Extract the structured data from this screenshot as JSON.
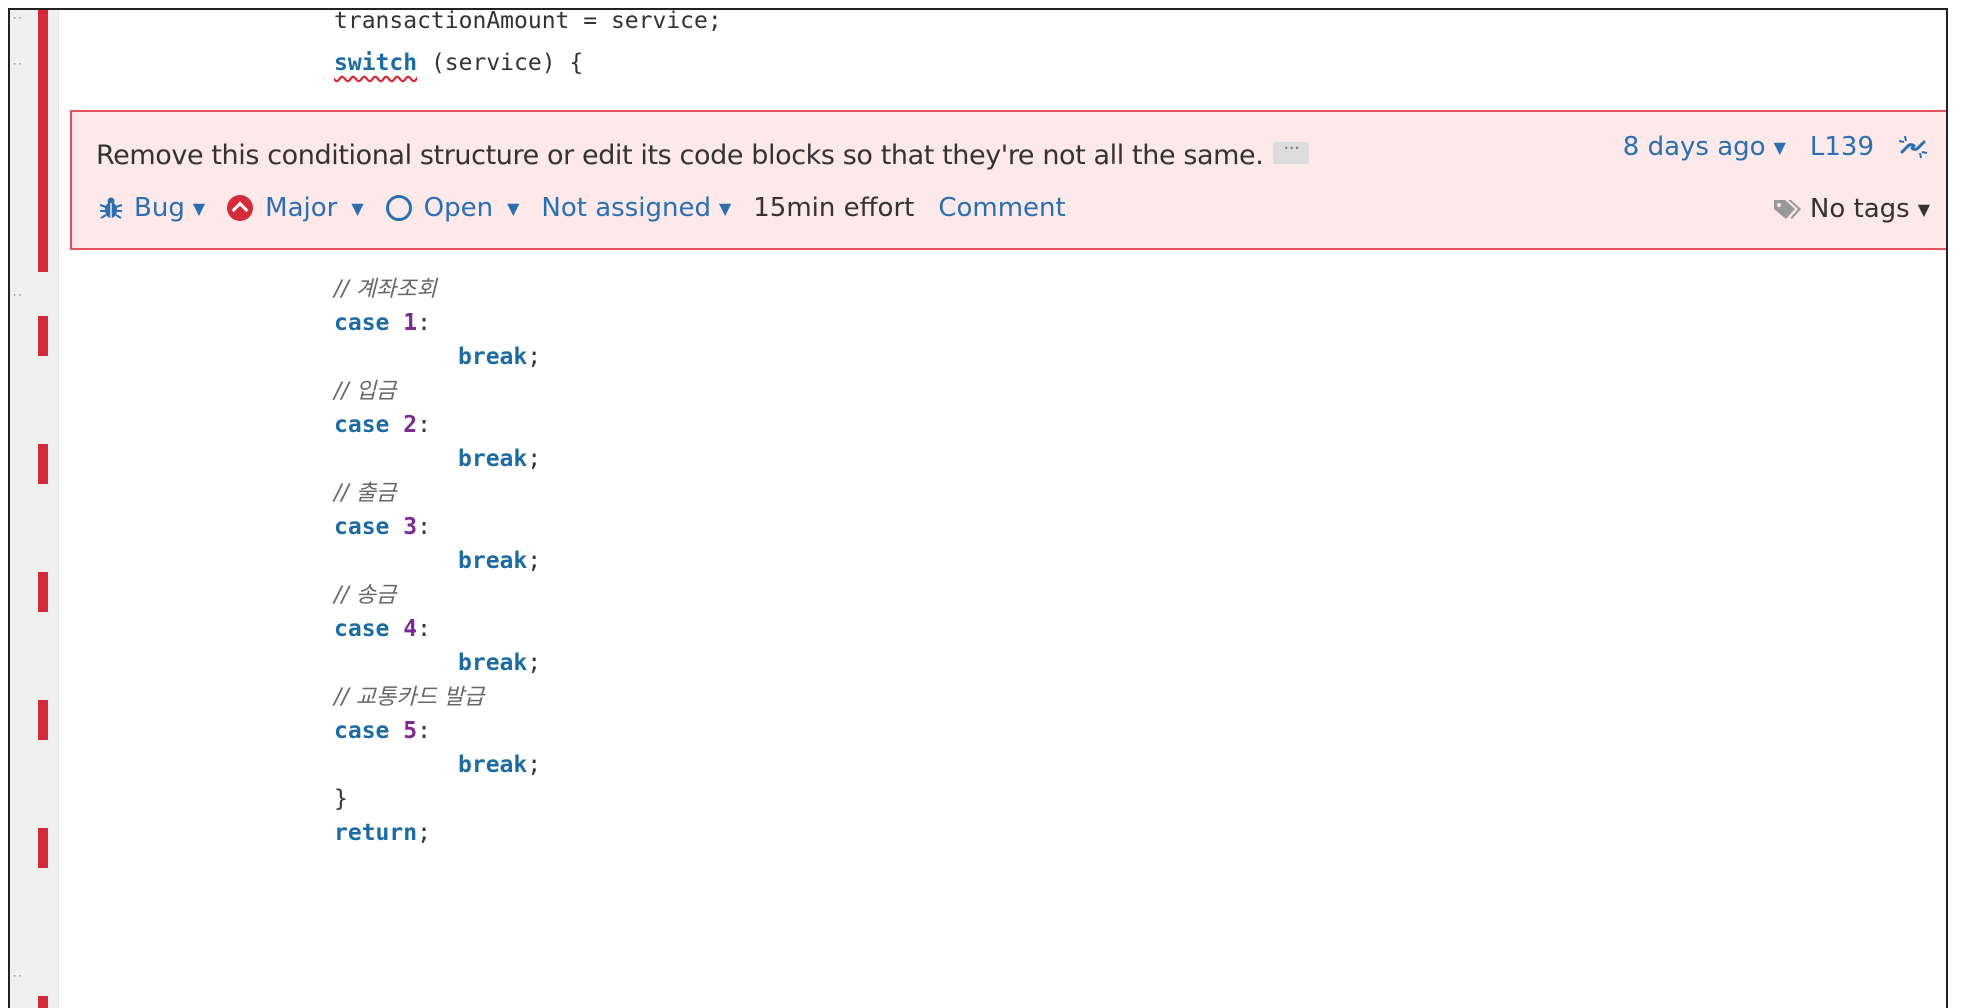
{
  "code": {
    "line_top": "transactionAmount = service;",
    "switch_kw": "switch",
    "switch_rest": " (service) {",
    "comment_1": "// 계좌조회",
    "comment_2": "// 입금",
    "comment_3": "// 출금",
    "comment_4": "// 송금",
    "comment_5": "// 교통카드 발급",
    "case_kw": "case",
    "case_1": "1",
    "case_2": "2",
    "case_3": "3",
    "case_4": "4",
    "case_5": "5",
    "colon": ":",
    "break_kw": "break",
    "semicolon": ";",
    "close_brace": "}",
    "return_kw": "return",
    "ellipsis": "··"
  },
  "issue": {
    "message": "Remove this conditional structure or edit its code blocks so that they're not all the same.",
    "more_label": "···",
    "type": "Bug",
    "severity": "Major",
    "status": "Open",
    "assignee": "Not assigned",
    "effort": "15min effort",
    "comment_label": "Comment",
    "age": "8 days ago",
    "line_ref": "L139",
    "tags": "No tags",
    "colors": {
      "background": "#fde8ea",
      "border": "#e0505e",
      "link": "#2a6fb0",
      "severity": "#d42a3a"
    }
  },
  "icons": {
    "type": "bug-icon",
    "severity": "major-severity-icon",
    "status": "open-status-icon",
    "permalink": "link-icon",
    "tags": "tag-icon",
    "caret": "caret-down-icon"
  }
}
